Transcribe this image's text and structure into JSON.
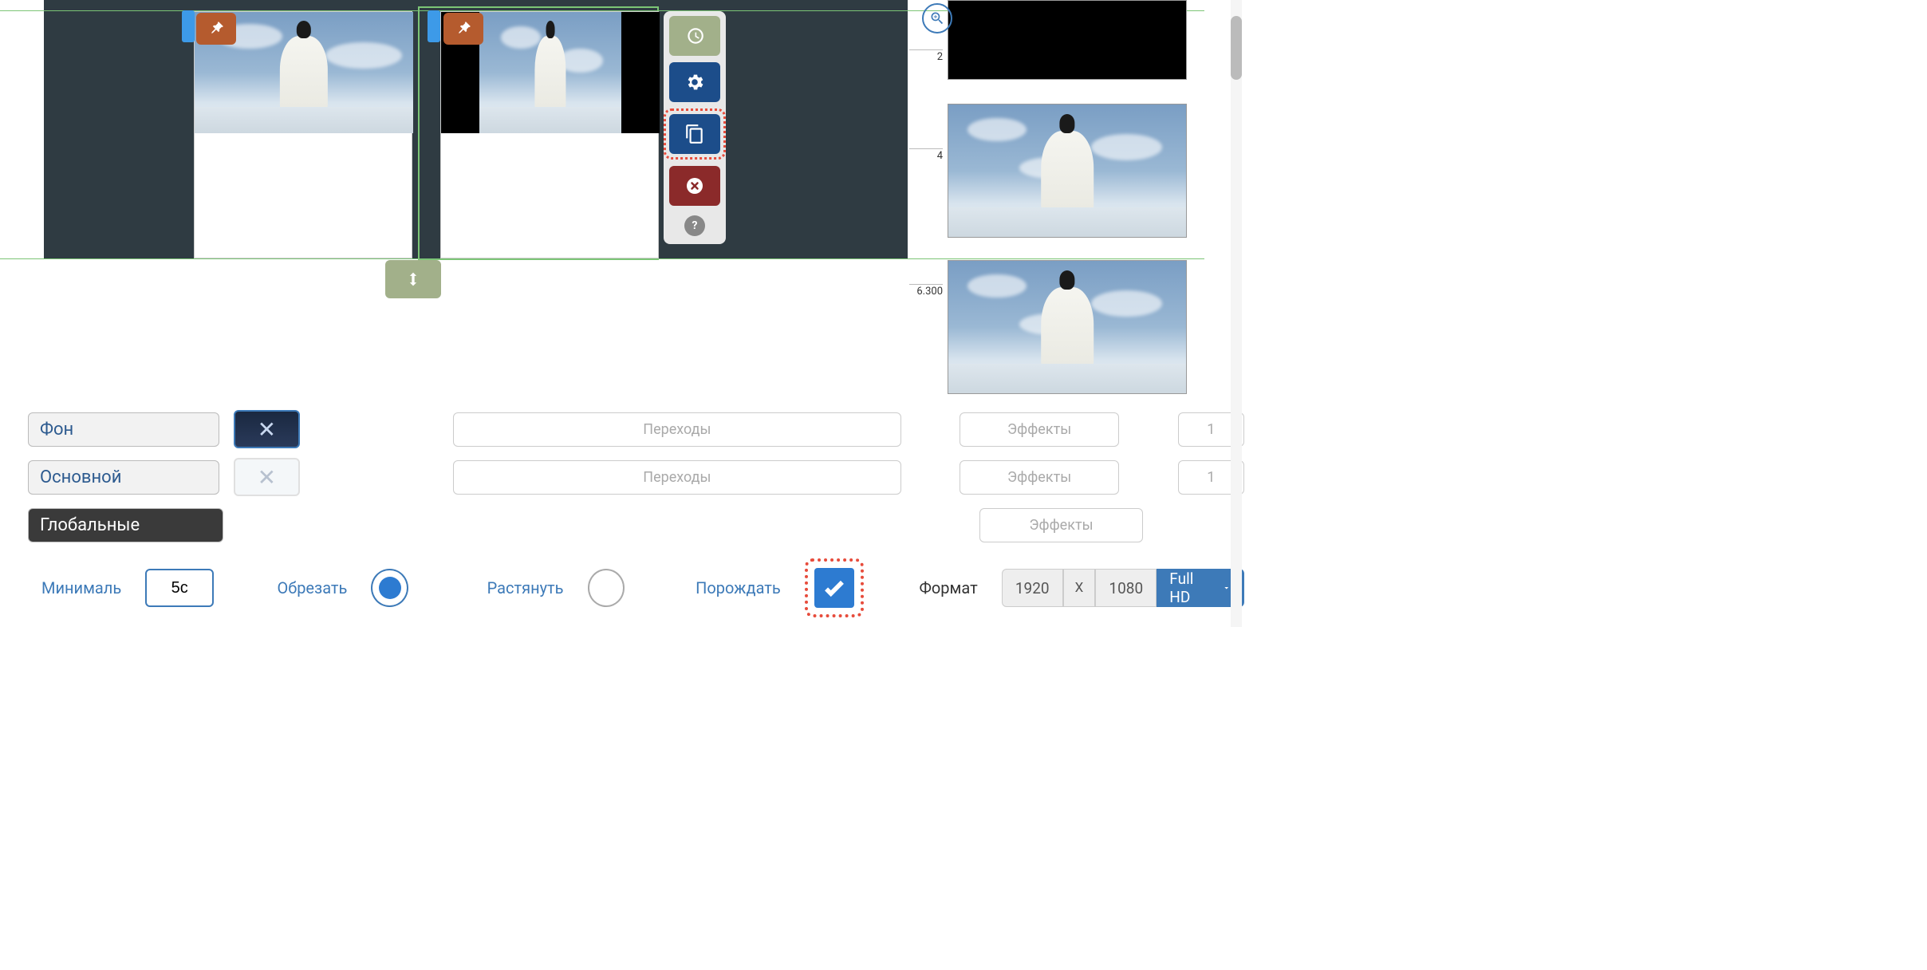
{
  "ruler": {
    "mark1": "2",
    "mark2": "4",
    "mark3": "6.300"
  },
  "layers": {
    "background": "Фон",
    "main": "Основной",
    "global": "Глобальные"
  },
  "transitions_label": "Переходы",
  "effects_label": "Эффекты",
  "counts": {
    "row1": "1",
    "row2": "1"
  },
  "footer": {
    "minimal": "Минималь",
    "duration": "5c",
    "crop": "Обрезать",
    "stretch": "Растянуть",
    "spawn": "Порождать",
    "format": "Формат",
    "width": "1920",
    "height": "1080",
    "separator": "X",
    "preset": "Full HD"
  },
  "help_icon": "?"
}
